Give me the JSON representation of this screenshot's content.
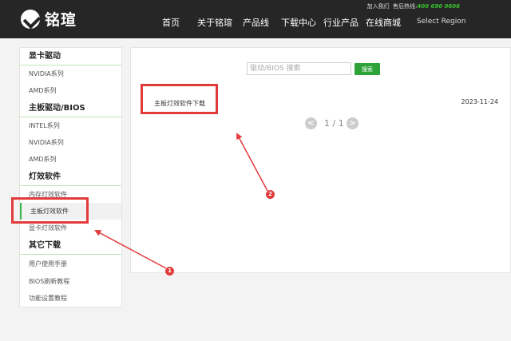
{
  "header": {
    "logo_text": "铭瑄",
    "join_link": "加入我们",
    "hotline_label": "售后热线:",
    "hotline_number": "400 696 0606",
    "nav": [
      "首页",
      "关于铭瑄",
      "产品线",
      "下载中心",
      "行业产品",
      "在线商城"
    ],
    "region": "Select Region"
  },
  "sidebar": {
    "groups": [
      {
        "title": "显卡驱动",
        "items": [
          "NVIDIA系列",
          "AMD系列"
        ]
      },
      {
        "title": "主板驱动/BIOS",
        "items": [
          "INTEL系列",
          "NVIDIA系列",
          "AMD系列"
        ]
      },
      {
        "title": "灯效软件",
        "items": [
          "内存灯效软件",
          "主板灯效软件",
          "显卡灯效软件"
        ]
      },
      {
        "title": "其它下载",
        "items": [
          "用户使用手册",
          "BIOS刷新教程",
          "功能设置教程"
        ]
      }
    ],
    "active_item": "主板灯效软件"
  },
  "main": {
    "search_placeholder": "驱动/BIOS 搜索",
    "search_button": "搜索",
    "file_name": "主板灯效软件下载",
    "file_date": "2023-11-24",
    "pager": {
      "prev": "<",
      "info": "1 / 1",
      "next": ">"
    }
  },
  "annotations": {
    "badge1": "1",
    "badge2": "2"
  },
  "colors": {
    "header_bg": "#262626",
    "accent_green": "#2ea33a",
    "annotation_red": "#e23b3b",
    "hotline_green": "#38c12f"
  }
}
